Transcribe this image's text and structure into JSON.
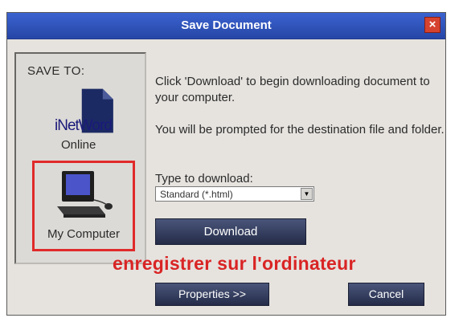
{
  "dialog": {
    "title": "Save Document",
    "close_icon": "×"
  },
  "left_panel": {
    "save_to_label": "SAVE TO:",
    "online_brand": "iNetWord",
    "online_label": "Online",
    "my_computer_label": "My Computer"
  },
  "main": {
    "message1": "Click 'Download' to begin downloading document to your computer.",
    "message2": "You will be prompted for the destination file and folder.",
    "type_label": "Type to download:",
    "type_value": "Standard (*.html)",
    "dropdown_arrow": "▼",
    "download_button": "Download"
  },
  "annotation": {
    "text": "enregistrer sur l'ordinateur",
    "color": "#d92424"
  },
  "footer": {
    "properties_button": "Properties >>",
    "cancel_button": "Cancel"
  },
  "colors": {
    "titlebar": "#2d4fb0",
    "highlight_border": "#e02a2a",
    "button": "#303b5e"
  }
}
